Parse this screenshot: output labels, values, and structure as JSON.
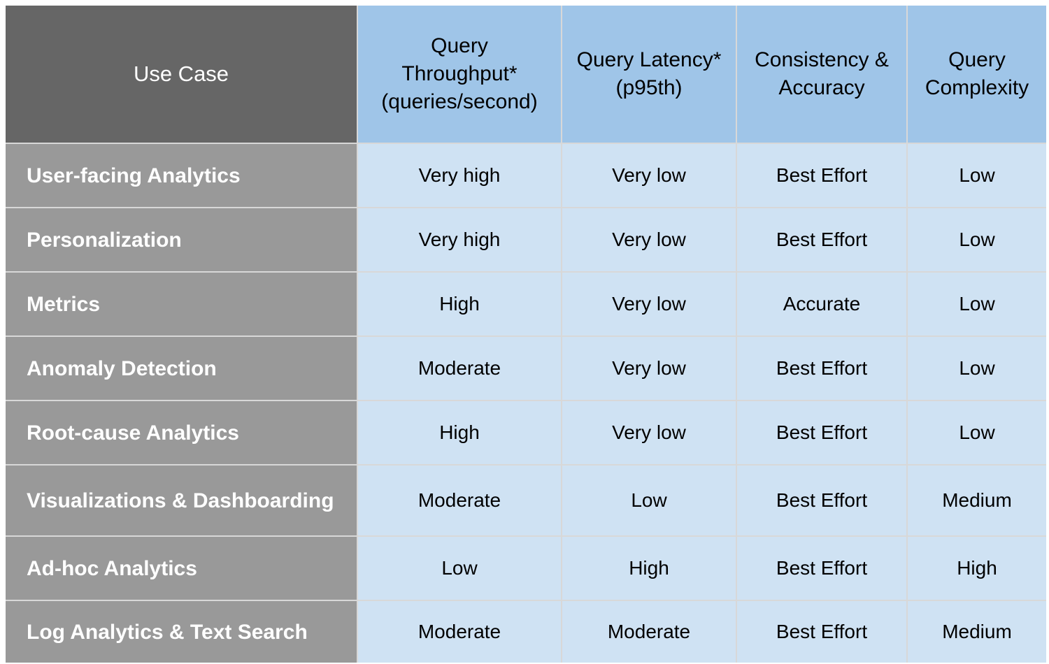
{
  "table": {
    "headers": [
      "Use Case",
      "Query Throughput* (queries/second)",
      "Query Latency* (p95th)",
      "Consistency & Accuracy",
      "Query Complexity"
    ],
    "header_lines": {
      "throughput": [
        "Query",
        "Throughput*",
        "(queries/second)"
      ],
      "latency": [
        "Query Latency*",
        "(p95th)"
      ],
      "consistency": [
        "Consistency &",
        "Accuracy"
      ],
      "complexity": [
        "Query",
        "Complexity"
      ]
    },
    "rows": [
      {
        "use_case": "User-facing Analytics",
        "throughput": "Very high",
        "latency": "Very low",
        "consistency": "Best Effort",
        "complexity": "Low"
      },
      {
        "use_case": "Personalization",
        "throughput": "Very high",
        "latency": "Very low",
        "consistency": "Best Effort",
        "complexity": "Low"
      },
      {
        "use_case": "Metrics",
        "throughput": "High",
        "latency": "Very low",
        "consistency": "Accurate",
        "complexity": "Low"
      },
      {
        "use_case": "Anomaly Detection",
        "throughput": "Moderate",
        "latency": "Very low",
        "consistency": "Best Effort",
        "complexity": "Low"
      },
      {
        "use_case": "Root-cause Analytics",
        "throughput": "High",
        "latency": "Very low",
        "consistency": "Best Effort",
        "complexity": "Low"
      },
      {
        "use_case": "Visualizations & Dashboarding",
        "throughput": "Moderate",
        "latency": "Low",
        "consistency": "Best Effort",
        "complexity": "Medium"
      },
      {
        "use_case": "Ad-hoc Analytics",
        "throughput": "Low",
        "latency": "High",
        "consistency": "Best Effort",
        "complexity": "High"
      },
      {
        "use_case": "Log Analytics & Text Search",
        "throughput": "Moderate",
        "latency": "Moderate",
        "consistency": "Best Effort",
        "complexity": "Medium"
      }
    ]
  },
  "colors": {
    "header_usecase_bg": "#666666",
    "header_bg": "#9fc5e8",
    "rowheader_bg": "#999999",
    "cell_bg": "#cfe2f3",
    "grid_line": "#d8d8d8"
  }
}
